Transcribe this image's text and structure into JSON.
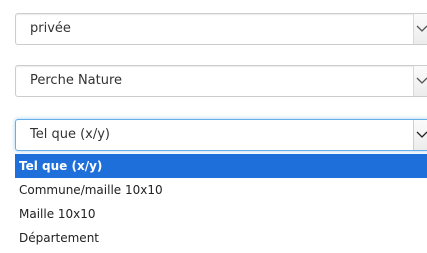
{
  "form": {
    "field1": {
      "value": "privée",
      "icon": "chevron-down-icon"
    },
    "field2": {
      "value": "Perche Nature",
      "icon": "chevron-down-icon"
    },
    "field3": {
      "value": "Tel que (x/y)",
      "icon": "chevron-down-icon",
      "focused": true,
      "options": [
        {
          "label": "Tel que (x/y)",
          "selected": true
        },
        {
          "label": "Commune/maille 10x10"
        },
        {
          "label": "Maille 10x10"
        },
        {
          "label": "Département"
        }
      ]
    }
  },
  "colors": {
    "focus_border": "#66afe9",
    "selected_option_bg": "#1e6fd9",
    "border": "#cccccc",
    "text": "#333333"
  }
}
